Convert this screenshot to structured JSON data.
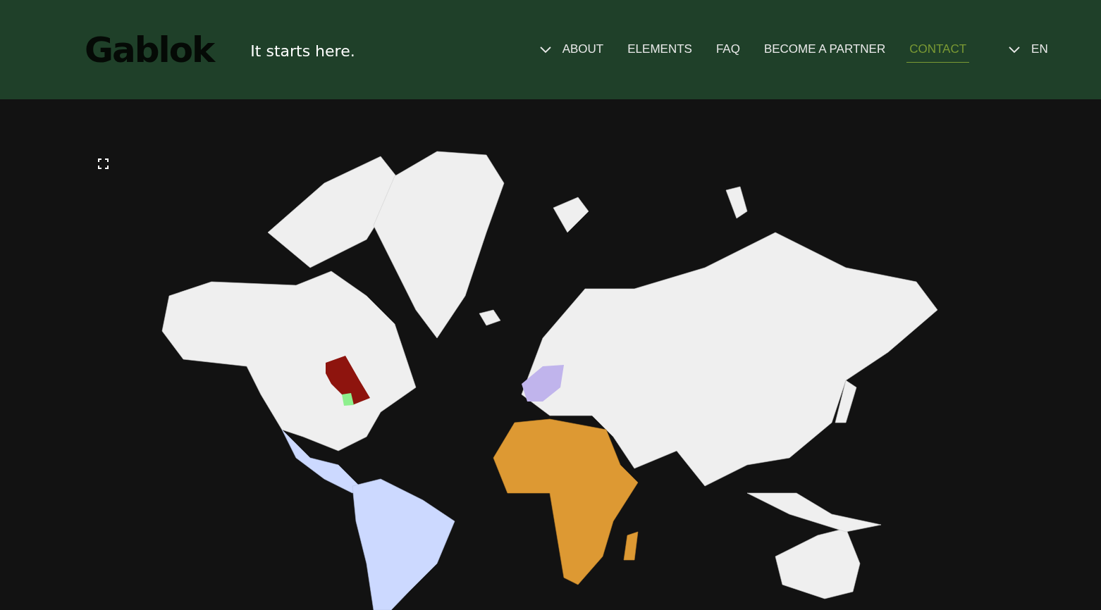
{
  "header": {
    "logo": "Gablok",
    "tagline": "It starts here."
  },
  "nav": [
    {
      "label": "ABOUT",
      "kind": "dropdown",
      "selected": false
    },
    {
      "label": "ELEMENTS",
      "kind": "link",
      "selected": false
    },
    {
      "label": "FAQ",
      "kind": "link",
      "selected": false
    },
    {
      "label": "BECOME A PARTNER",
      "kind": "link",
      "selected": false
    },
    {
      "label": "CONTACT",
      "kind": "link",
      "selected": true
    }
  ],
  "language": {
    "label": "EN"
  }
}
